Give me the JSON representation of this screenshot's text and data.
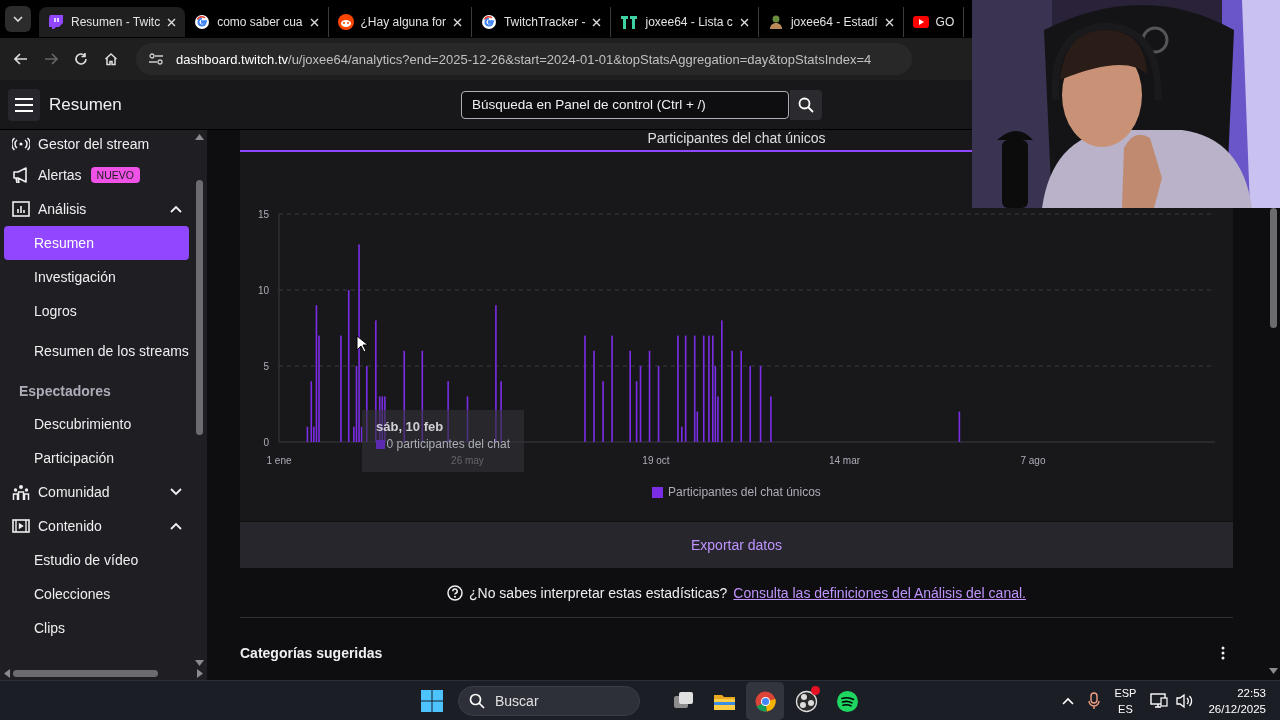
{
  "browser": {
    "tabs": [
      {
        "title": "Resumen - Twitc",
        "selected": true
      },
      {
        "title": "como saber cua",
        "selected": false
      },
      {
        "title": "¿Hay alguna for",
        "selected": false
      },
      {
        "title": "TwitchTracker -",
        "selected": false
      },
      {
        "title": "joxee64 - Lista c",
        "selected": false
      },
      {
        "title": "joxee64 - Estadí",
        "selected": false
      },
      {
        "title": "GO",
        "selected": false
      }
    ],
    "url": {
      "host": "dashboard.twitch.tv",
      "path": "/u/joxee64/analytics?end=2025-12-26&start=2024-01-01&topStatsAggregation=day&topStatsIndex=4"
    }
  },
  "topbar": {
    "title": "Resumen",
    "search": {
      "placeholder": "Búsqueda en Panel de control (Ctrl + /)"
    }
  },
  "sidebar": {
    "items": [
      {
        "label": "Gestor del stream",
        "kind": "link"
      },
      {
        "label": "Alertas",
        "kind": "link",
        "badge": "NUEVO"
      },
      {
        "label": "Análisis",
        "kind": "group",
        "expanded": true,
        "children": [
          {
            "label": "Resumen",
            "kind": "link",
            "selected": true
          },
          {
            "label": "Investigación",
            "kind": "link",
            "selected": false
          },
          {
            "label": "Logros",
            "kind": "link",
            "selected": false
          },
          {
            "label": "Resumen de los streams",
            "kind": "link",
            "selected": false
          },
          {
            "label": "Espectadores",
            "kind": "heading",
            "children": [
              {
                "label": "Descubrimiento",
                "kind": "link",
                "selected": false
              },
              {
                "label": "Participación",
                "kind": "link",
                "selected": false
              }
            ]
          }
        ]
      },
      {
        "label": "Comunidad",
        "kind": "group",
        "expanded": false
      },
      {
        "label": "Contenido",
        "kind": "group",
        "expanded": true,
        "children": [
          {
            "label": "Estudio de vídeo",
            "kind": "link",
            "selected": false
          },
          {
            "label": "Colecciones",
            "kind": "link",
            "selected": false
          },
          {
            "label": "Clips",
            "kind": "link",
            "selected": false
          }
        ]
      }
    ]
  },
  "chart_card": {
    "chart_data": {
      "type": "bar",
      "title": "Participantes del chat únicos",
      "x": [
        "2024-01-23",
        "2024-01-26",
        "2024-01-28",
        "2024-01-30",
        "2024-02-01",
        "2024-02-18",
        "2024-02-24",
        "2024-02-28",
        "2024-03-01",
        "2024-03-03",
        "2024-03-05",
        "2024-03-09",
        "2024-03-16",
        "2024-03-19",
        "2024-03-21",
        "2024-03-23",
        "2024-04-07",
        "2024-04-21",
        "2024-05-11",
        "2024-05-26",
        "2024-06-17",
        "2024-06-21",
        "2024-08-25",
        "2024-09-01",
        "2024-09-08",
        "2024-09-15",
        "2024-09-29",
        "2024-10-04",
        "2024-10-07",
        "2024-10-14",
        "2024-10-21",
        "2024-11-05",
        "2024-11-08",
        "2024-11-11",
        "2024-11-18",
        "2024-11-20",
        "2024-11-25",
        "2024-11-29",
        "2024-12-02",
        "2024-12-04",
        "2024-12-06",
        "2024-12-09",
        "2024-12-17",
        "2024-12-24",
        "2024-12-31",
        "2025-01-08",
        "2025-01-16",
        "2025-06-11"
      ],
      "series": [
        {
          "name": "Participantes del chat únicos",
          "color": "#7b2de6",
          "values": [
            1,
            4,
            1,
            9,
            7,
            7,
            10,
            1,
            5,
            13,
            1,
            5,
            8,
            3,
            3,
            3,
            6,
            6,
            4,
            3,
            9,
            4,
            7,
            6,
            4,
            7,
            6,
            4,
            5,
            6,
            5,
            7,
            1,
            7,
            7,
            2,
            7,
            7,
            7,
            5,
            3,
            8,
            6,
            6,
            5,
            5,
            3,
            2
          ]
        }
      ],
      "xlim": [
        "2024-01-01",
        "2025-12-26"
      ],
      "ylim": [
        0,
        15
      ],
      "yticks": [
        0,
        5,
        10,
        15
      ],
      "xticks": [
        {
          "value": "2024-01-01",
          "label": "1 ene"
        },
        {
          "value": "2024-05-26",
          "label": "26 may"
        },
        {
          "value": "2024-10-19",
          "label": "19 oct"
        },
        {
          "value": "2025-03-14",
          "label": "14 mar"
        },
        {
          "value": "2025-08-07",
          "label": "7 ago"
        }
      ]
    },
    "tooltip": {
      "title": "sáb, 10 feb",
      "text": "0 participantes del chat"
    },
    "export_button": "Exportar datos"
  },
  "help": {
    "text": "¿No sabes interpretar estas estadísticas?",
    "link": "Consulta las definiciones del Análisis del canal."
  },
  "section": {
    "title": "Categorías sugeridas"
  },
  "taskbar": {
    "search": {
      "placeholder": "Buscar"
    },
    "apps": [
      {
        "active": false,
        "alert": false
      },
      {
        "active": false,
        "alert": false
      },
      {
        "active": true,
        "alert": false
      },
      {
        "active": false,
        "alert": true
      },
      {
        "active": false,
        "alert": false
      }
    ],
    "language": {
      "code": "ESP",
      "layout": "ES"
    },
    "time": "22:53",
    "date": "26/12/2025"
  }
}
